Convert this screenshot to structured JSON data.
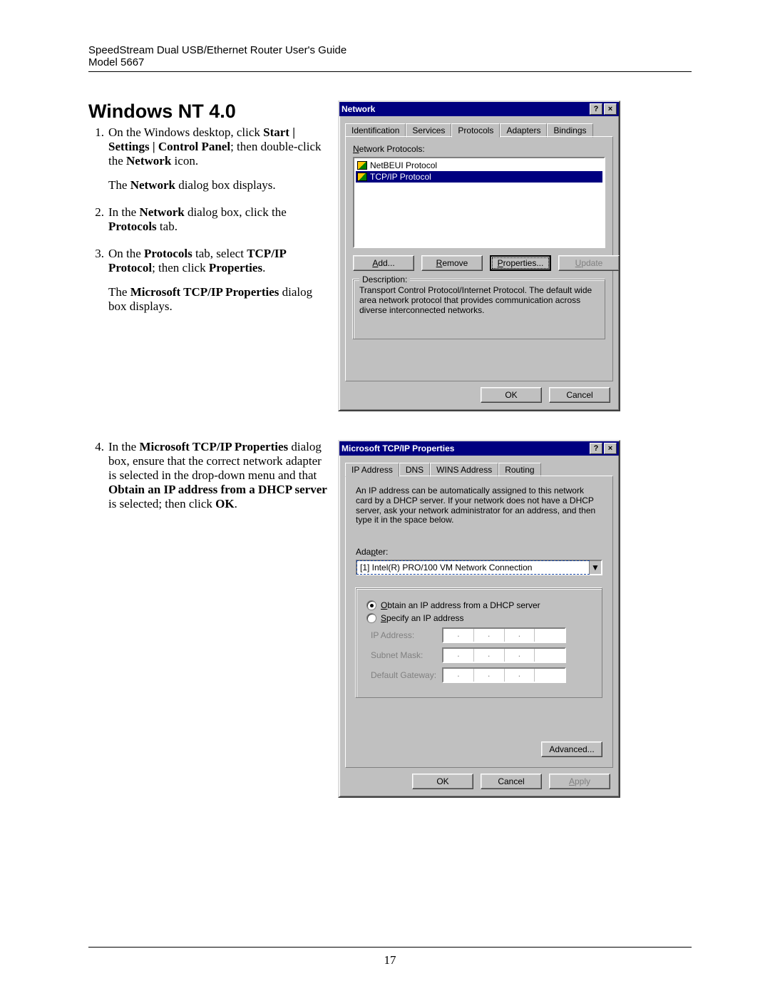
{
  "header": {
    "title": "SpeedStream Dual USB/Ethernet Router User's Guide",
    "model": "Model 5667"
  },
  "page_number": "17",
  "heading": "Windows NT 4.0",
  "steps": {
    "s1_a": "On the Windows desktop, click ",
    "s1_b": "Start | Settings | Control Panel",
    "s1_c": "; then double-click the ",
    "s1_d": "Network",
    "s1_e": " icon.",
    "s1_f": "The ",
    "s1_g": "Network",
    "s1_h": " dialog box displays.",
    "s2_a": "In the ",
    "s2_b": "Network",
    "s2_c": " dialog box, click the ",
    "s2_d": "Protocols",
    "s2_e": " tab.",
    "s3_a": "On the ",
    "s3_b": "Protocols",
    "s3_c": " tab, select ",
    "s3_d": "TCP/IP Protocol",
    "s3_e": "; then click ",
    "s3_f": "Properties",
    "s3_g": ".",
    "s3_h": "The ",
    "s3_i": "Microsoft TCP/IP Properties",
    "s3_j": " dialog box displays.",
    "s4_a": "In the ",
    "s4_b": "Microsoft TCP/IP Properties",
    "s4_c": " dialog box, ensure that the correct network adapter is selected in the drop-down menu and that ",
    "s4_d": "Obtain an IP address from a DHCP server",
    "s4_e": " is selected; then click ",
    "s4_f": "OK",
    "s4_g": "."
  },
  "dlg1": {
    "title": "Network",
    "tabs": [
      "Identification",
      "Services",
      "Protocols",
      "Adapters",
      "Bindings"
    ],
    "list_label_pre": "N",
    "list_label": "etwork Protocols:",
    "items": [
      "NetBEUI Protocol",
      "TCP/IP Protocol"
    ],
    "btn_add_u": "A",
    "btn_add": "dd...",
    "btn_rem_u": "R",
    "btn_rem": "emove",
    "btn_prop_u": "P",
    "btn_prop": "roperties...",
    "btn_upd_u": "U",
    "btn_upd": "pdate",
    "grp": "Description:",
    "desc": "Transport Control Protocol/Internet Protocol. The default wide area network protocol that provides communication across diverse interconnected networks.",
    "ok": "OK",
    "cancel": "Cancel"
  },
  "dlg2": {
    "title": "Microsoft TCP/IP Properties",
    "tabs": [
      "IP Address",
      "DNS",
      "WINS Address",
      "Routing"
    ],
    "intro": "An IP address can be automatically assigned to this network card by a DHCP server.  If your network does not have a DHCP server, ask your network administrator for an address, and then type it in the space below.",
    "adapter_u": "p",
    "adapter_label_pre": "Ada",
    "adapter_label_post": "ter:",
    "adapter_value": "[1] Intel(R) PRO/100 VM Network Connection",
    "opt1_u": "O",
    "opt1": "btain an IP address from a DHCP server",
    "opt2_u": "S",
    "opt2": "pecify an IP address",
    "f_ip": "IP Address:",
    "f_mask": "Subnet Mask:",
    "f_gw": "Default Gateway:",
    "advanced": "Advanced...",
    "ok": "OK",
    "cancel": "Cancel",
    "apply_u": "A",
    "apply": "pply"
  }
}
